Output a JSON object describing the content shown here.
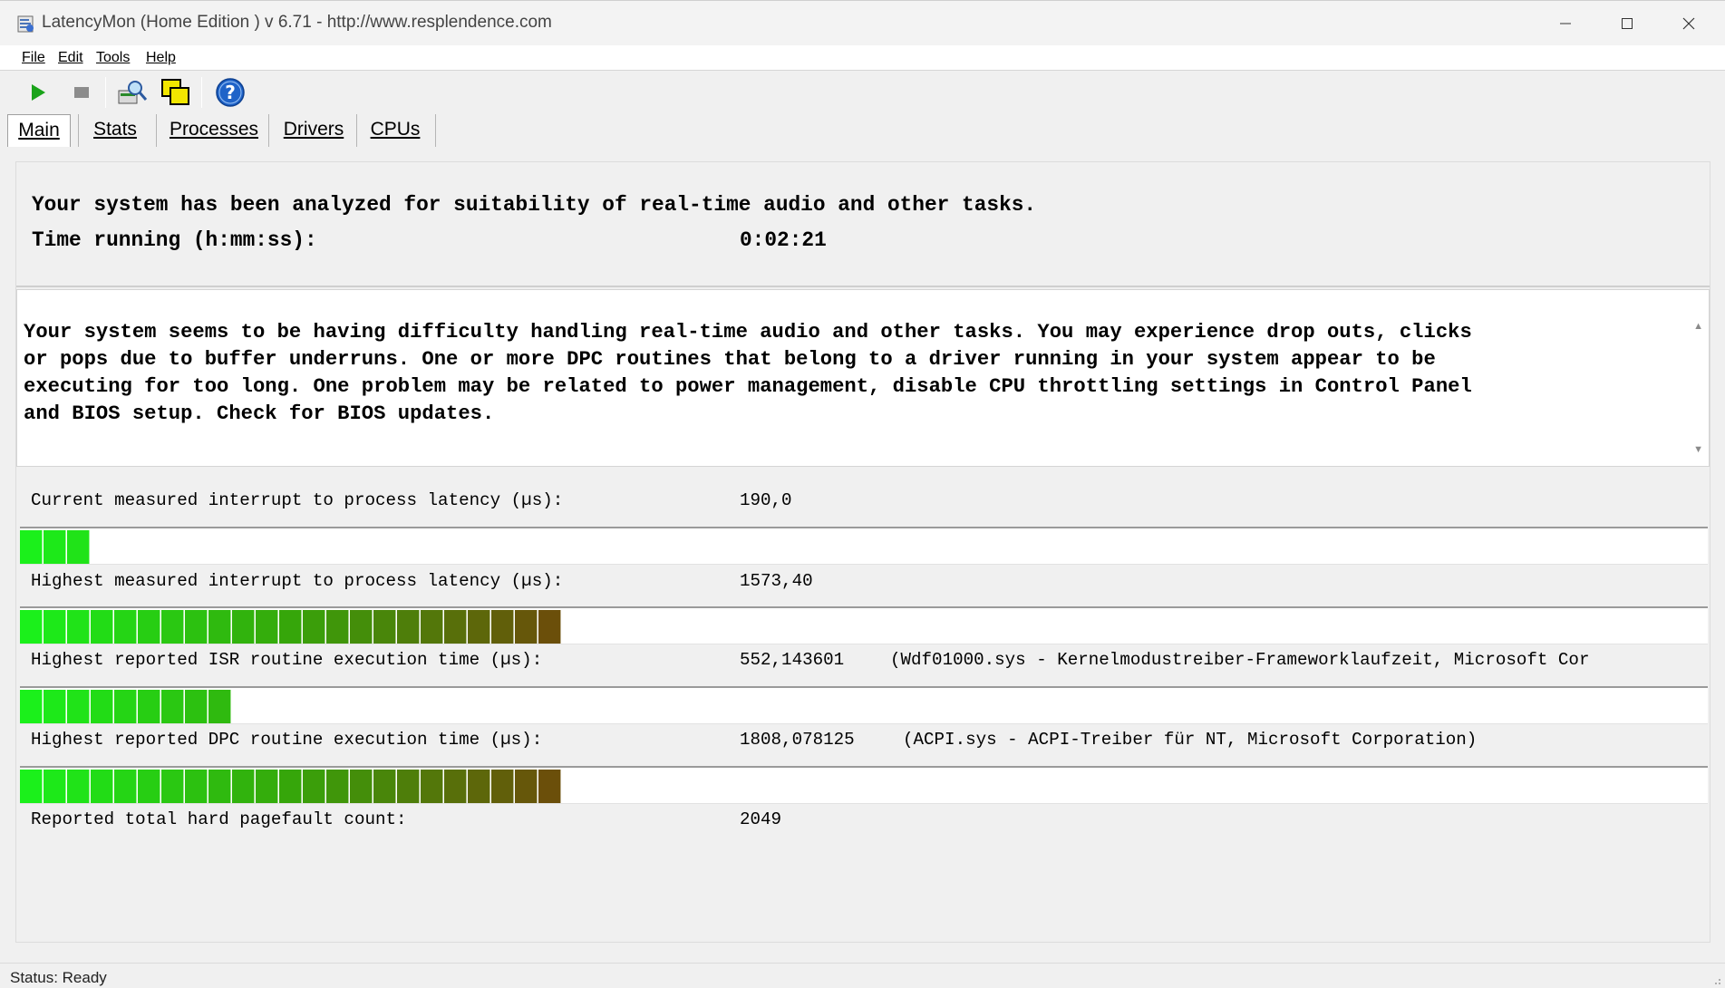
{
  "window": {
    "title": "LatencyMon  (Home Edition )  v 6.71 - http://www.resplendence.com",
    "controls": [
      "minimize",
      "maximize",
      "close"
    ]
  },
  "menu": {
    "items": [
      {
        "label": "File"
      },
      {
        "label": "Edit"
      },
      {
        "label": "Tools"
      },
      {
        "label": "Help"
      }
    ]
  },
  "toolbar": {
    "buttons": [
      {
        "icon": "play-icon",
        "color": "#1aa31a"
      },
      {
        "icon": "stop-icon",
        "color": "#8c8c8c"
      },
      {
        "icon": "search-driver-icon"
      },
      {
        "icon": "copy-windows-icon",
        "color": "#f2e600"
      },
      {
        "icon": "help-icon",
        "color": "#1f63c8"
      }
    ]
  },
  "tabs": [
    {
      "label": "Main",
      "active": true
    },
    {
      "label": "Stats"
    },
    {
      "label": "Processes"
    },
    {
      "label": "Drivers"
    },
    {
      "label": "CPUs"
    }
  ],
  "summary": {
    "headline": "Your system has been analyzed for suitability of real-time audio and other tasks.",
    "time_label": "Time running (h:mm:ss):",
    "time_value": "0:02:21"
  },
  "message": {
    "text": "Your system seems to be having difficulty handling real-time audio and other tasks. You may experience drop outs, clicks\nor pops due to buffer underruns. One or more DPC routines that belong to a driver running in your system appear to be\nexecuting for too long. One problem may be related to power management, disable CPU throttling settings in Control Panel\nand BIOS setup. Check for BIOS updates."
  },
  "metrics": {
    "current_latency": {
      "label": "Current measured interrupt to process latency (µs):",
      "value": "190,0",
      "bar_segments": 3
    },
    "highest_latency": {
      "label": "Highest measured interrupt to process latency (µs):",
      "value": "1573,40",
      "bar_segments": 23
    },
    "isr": {
      "label": "Highest reported ISR routine execution time (µs):",
      "value": "552,143601",
      "detail": "(Wdf01000.sys - Kernelmodustreiber-Frameworklaufzeit, Microsoft Cor",
      "bar_segments": 9
    },
    "dpc": {
      "label": "Highest reported DPC routine execution time (µs):",
      "value": "1808,078125",
      "detail": "(ACPI.sys - ACPI-Treiber für NT, Microsoft Corporation)",
      "bar_segments": 23
    },
    "pagefault": {
      "label": "Reported total hard pagefault count:",
      "value": "2049"
    }
  },
  "status": {
    "text": "Status: Ready"
  },
  "colors": {
    "bar_start": "#1bf01b",
    "bar_mid": "#36a60a",
    "bar_end": "#6b4f0a"
  }
}
